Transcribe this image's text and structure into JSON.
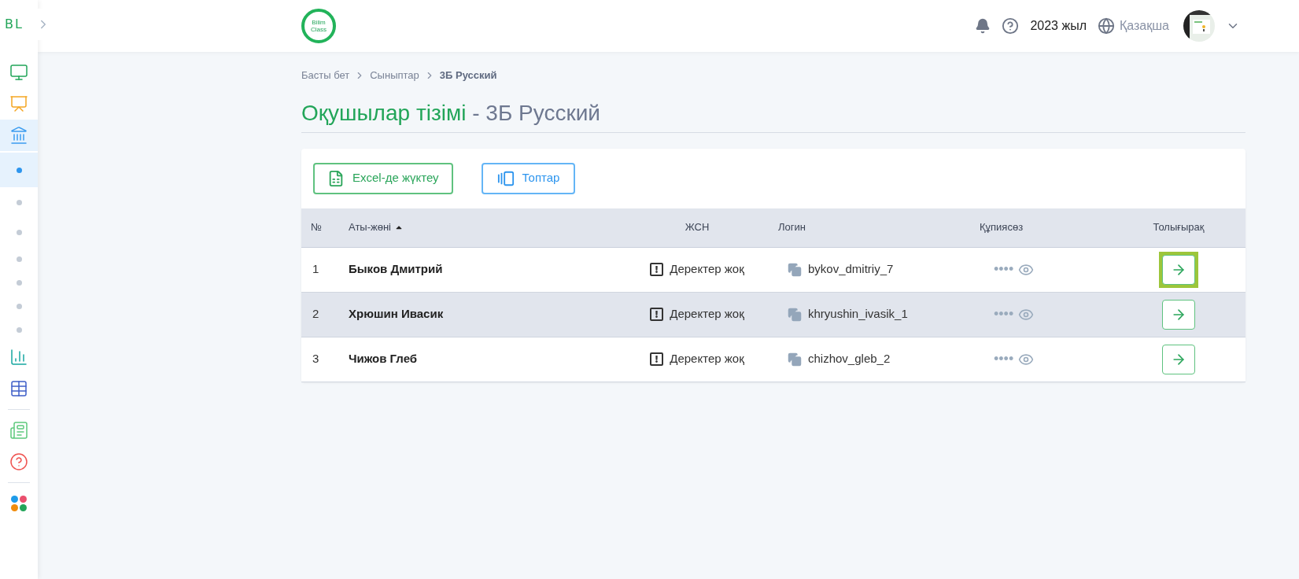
{
  "sidebar": {
    "logo": "BL",
    "items": [
      {
        "kind": "monitor",
        "selected": false
      },
      {
        "kind": "teacher",
        "selected": false
      },
      {
        "kind": "school",
        "selected": true,
        "expanded": true,
        "children": [
          {
            "selected": true
          },
          {
            "selected": false
          },
          {
            "selected": false
          },
          {
            "selected": false
          },
          {
            "selected": false
          },
          {
            "selected": false
          },
          {
            "selected": false
          }
        ]
      },
      {
        "kind": "chart",
        "selected": false
      },
      {
        "kind": "table",
        "selected": false
      },
      {
        "kind": "divider"
      },
      {
        "kind": "news",
        "selected": false
      },
      {
        "kind": "help",
        "selected": false
      },
      {
        "kind": "divider"
      },
      {
        "kind": "apps",
        "selected": false
      }
    ]
  },
  "header": {
    "logo": [
      "Bilim",
      "Class"
    ],
    "year": "2023 жыл",
    "language": "Қазақша",
    "notifications": {
      "kind": "bell"
    }
  },
  "breadcrumb": [
    {
      "label": "Басты бет",
      "current": false
    },
    {
      "label": "Сыныптар",
      "current": false
    },
    {
      "label": "3Б Русский",
      "current": true
    }
  ],
  "title": {
    "main": "Оқушылар тізімі",
    "suffix": "- 3Б Русский"
  },
  "toolbar": [
    {
      "kind": "excel",
      "label": "Excel-де жүктеу"
    },
    {
      "kind": "groups",
      "label": "Топтар"
    }
  ],
  "table": {
    "columns": [
      {
        "label": "№",
        "sorted": false
      },
      {
        "label": "Аты-жөні",
        "sorted": true
      },
      {
        "label": "ЖСН",
        "sorted": false
      },
      {
        "label": "Логин",
        "sorted": false
      },
      {
        "label": "Құпиясөз",
        "sorted": false
      },
      {
        "label": "Толығырақ",
        "sorted": false
      }
    ],
    "rows": [
      {
        "number": "1",
        "name": "Быков Дмитрий",
        "iin": "Деректер жоқ",
        "login": "bykov_dmitriy_7",
        "password": "••••",
        "selected": false,
        "focused": true
      },
      {
        "number": "2",
        "name": "Хрюшин Ивасик",
        "iin": "Деректер жоқ",
        "login": "khryushin_ivasik_1",
        "password": "••••",
        "selected": true,
        "focused": false
      },
      {
        "number": "3",
        "name": "Чижов Глеб",
        "iin": "Деректер жоқ",
        "login": "chizhov_gleb_2",
        "password": "••••",
        "selected": false,
        "focused": false
      }
    ]
  }
}
